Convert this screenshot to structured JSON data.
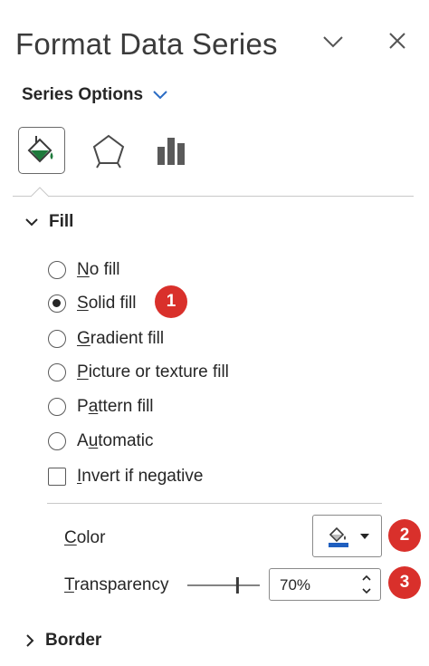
{
  "header": {
    "title": "Format Data Series",
    "collapse_icon": "chevron-down-icon",
    "close_icon": "close-icon"
  },
  "series_options": {
    "label": "Series Options",
    "dropdown_icon": "chevron-down-icon"
  },
  "tabs": [
    {
      "name": "Fill & Line",
      "icon": "paint-bucket-icon",
      "selected": true
    },
    {
      "name": "Effects",
      "icon": "pentagon-icon",
      "selected": false
    },
    {
      "name": "Series Options",
      "icon": "bar-chart-icon",
      "selected": false
    }
  ],
  "fill": {
    "label": "Fill",
    "options": [
      {
        "key": "N",
        "rest": "o fill",
        "selected": false
      },
      {
        "key": "S",
        "rest": "olid fill",
        "selected": true
      },
      {
        "key": "G",
        "rest": "radient fill",
        "selected": false
      },
      {
        "key": "P",
        "rest": "icture or texture fill",
        "selected": false
      },
      {
        "key_pre": "P",
        "key": "a",
        "rest": "ttern fill",
        "selected": false
      },
      {
        "key_pre": "A",
        "key": "u",
        "rest": "tomatic",
        "selected": false
      }
    ],
    "invert": {
      "key": "I",
      "rest": "nvert if negative",
      "checked": false
    },
    "color": {
      "key": "C",
      "rest": "olor",
      "swatch": "#1f5fbf"
    },
    "transparency": {
      "key": "T",
      "rest": "ransparency",
      "value": "70%",
      "level": 0.7
    }
  },
  "border": {
    "label": "Border"
  },
  "badges": [
    "1",
    "2",
    "3"
  ],
  "colors": {
    "badge": "#d9302b",
    "accent_green": "#1e7a3c",
    "accent_blue": "#2b6cc4"
  }
}
